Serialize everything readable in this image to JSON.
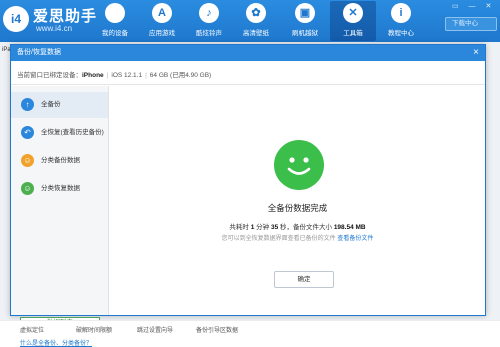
{
  "brand": {
    "name": "爱思助手",
    "url": "www.i4.cn",
    "logo": "i4"
  },
  "nav": [
    {
      "label": "我的设备",
      "icon": "apple-icon",
      "glyph": "",
      "active": false
    },
    {
      "label": "应用游戏",
      "icon": "app-store-icon",
      "glyph": "A",
      "active": false
    },
    {
      "label": "酷炫铃声",
      "icon": "bell-icon",
      "glyph": "♪",
      "active": false
    },
    {
      "label": "高清壁纸",
      "icon": "flower-icon",
      "glyph": "✿",
      "active": false
    },
    {
      "label": "刷机越狱",
      "icon": "box-icon",
      "glyph": "▣",
      "active": false
    },
    {
      "label": "工具箱",
      "icon": "tools-icon",
      "glyph": "✕",
      "active": true
    },
    {
      "label": "教程中心",
      "icon": "info-icon",
      "glyph": "i",
      "active": false
    }
  ],
  "download_label": "下载中心",
  "bg_tab": "iPa",
  "dialog": {
    "title": "备份/恢复数据",
    "device_prefix": "当前窗口已绑定设备：",
    "device_name": "iPhone",
    "ios": "iOS 12.1.1",
    "storage": "64 GB (已用4.90 GB)",
    "close": "×"
  },
  "sidebar": {
    "items": [
      {
        "label": "全备份",
        "icon": "backup-icon",
        "glyph": "↑",
        "color": "#2a87db",
        "active": true
      },
      {
        "label": "全恢复(查看历史备份)",
        "icon": "restore-icon",
        "glyph": "↶",
        "color": "#2a87db",
        "active": false
      },
      {
        "label": "分类备份数据",
        "icon": "category-backup-icon",
        "glyph": "☺",
        "color": "#f0a22c",
        "active": false
      },
      {
        "label": "分类恢复数据",
        "icon": "category-restore-icon",
        "glyph": "☺",
        "color": "#4caf50",
        "active": false
      }
    ],
    "list_button": "数据列表",
    "help_link": "什么是全备份、分类备份？"
  },
  "result": {
    "title": "全备份数据完成",
    "stats_prefix": "共耗时",
    "minutes": "1",
    "minutes_unit": "分钟",
    "seconds": "35",
    "seconds_unit": "秒，备份文件大小",
    "size": "198.54 MB",
    "hint": "您可以到全恢复数据界面查看已备份的文件",
    "view_link": "查看备份文件",
    "ok_button": "确定"
  },
  "bottom": [
    "虚拟定位",
    "破解时间限额",
    "跳过设置向导",
    "备份引导区数据"
  ],
  "colors": {
    "brand_blue": "#1f78cd",
    "success_green": "#3cbf4a"
  }
}
